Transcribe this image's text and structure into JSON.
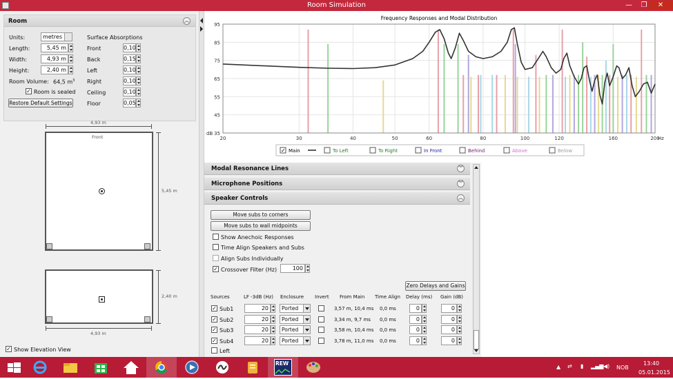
{
  "window": {
    "title": "Room Simulation",
    "buttons": [
      "—",
      "❐",
      "✕"
    ]
  },
  "room_panel": {
    "title": "Room",
    "units_label": "Units:",
    "units_value": "metres",
    "length_label": "Length:",
    "length_value": "5,45 m",
    "width_label": "Width:",
    "width_value": "4,93 m",
    "height_label": "Height:",
    "height_value": "2,40 m",
    "volume_label": "Room Volume:",
    "volume_value": "64,5 m",
    "volume_sup": "3",
    "sealed_label": "Room is sealed",
    "sealed_checked": true,
    "restore_button": "Restore Default Settings",
    "absorptions_title": "Surface Absorptions",
    "absorptions": [
      {
        "label": "Front",
        "value": "0,10"
      },
      {
        "label": "Back",
        "value": "0,15"
      },
      {
        "label": "Left",
        "value": "0,10"
      },
      {
        "label": "Right",
        "value": "0,10"
      },
      {
        "label": "Ceiling",
        "value": "0,10"
      },
      {
        "label": "Floor",
        "value": "0,05"
      }
    ]
  },
  "plan_view": {
    "width_dim": "4,93 m",
    "length_dim": "5,45 m",
    "front_label": "Front"
  },
  "elevation_view": {
    "height_dim": "2,40 m",
    "width_dim": "4,93 m"
  },
  "show_elevation": {
    "label": "Show Elevation View",
    "checked": true
  },
  "chart_data": {
    "type": "line",
    "title": "Frequency Responses and Modal Distribution",
    "ylabel": "dB",
    "xscale": "log",
    "xlim": [
      20,
      200
    ],
    "ylim": [
      35,
      95
    ],
    "x_ticks": [
      20,
      30,
      40,
      50,
      60,
      80,
      100,
      120,
      160,
      200
    ],
    "x_unit": "Hz",
    "y_ticks": [
      35,
      45,
      55,
      65,
      75,
      85,
      95
    ],
    "grid": true,
    "series": [
      {
        "name": "Main",
        "color": "#333333",
        "x": [
          20,
          25,
          30,
          35,
          40,
          45,
          50,
          55,
          58,
          60,
          62,
          63.5,
          65,
          66.5,
          67.5,
          69,
          70.5,
          72,
          74,
          77,
          80,
          84,
          88,
          91,
          93,
          94.5,
          96,
          98,
          100,
          104,
          108,
          110,
          112,
          115,
          118,
          121,
          123,
          125,
          127,
          130,
          133,
          135,
          137,
          139,
          141,
          143,
          145,
          147,
          149,
          151,
          153,
          155,
          157,
          160,
          163,
          165,
          168,
          171,
          174,
          177,
          180,
          184,
          188,
          192,
          196,
          200
        ],
        "y": [
          73,
          72,
          71.2,
          70.7,
          70.5,
          71,
          72.5,
          76,
          80,
          85,
          90.5,
          92,
          87,
          79,
          76,
          82,
          90,
          86,
          80,
          77,
          76,
          77,
          80,
          85,
          92,
          93,
          84,
          74,
          70,
          71,
          77,
          80,
          77,
          71,
          68,
          70,
          76,
          79,
          72,
          66,
          62,
          65,
          71,
          72,
          64,
          58,
          64,
          67,
          56,
          51,
          63,
          68,
          61,
          66,
          72,
          71,
          65,
          67,
          71,
          61,
          55,
          58,
          62,
          63,
          57,
          62
        ]
      }
    ],
    "modal_lines": [
      {
        "freq": 31.5,
        "level": 92,
        "color": "#e8a0a8"
      },
      {
        "freq": 35,
        "level": 84,
        "color": "#9ad49a"
      },
      {
        "freq": 47,
        "level": 64,
        "color": "#e6d890"
      },
      {
        "freq": 63,
        "level": 92,
        "color": "#e8a0a8"
      },
      {
        "freq": 65,
        "level": 84,
        "color": "#9ad49a"
      },
      {
        "freq": 70,
        "level": 84,
        "color": "#9ad49a"
      },
      {
        "freq": 72,
        "level": 67,
        "color": "#e8a0a8"
      },
      {
        "freq": 74,
        "level": 78,
        "color": "#b0a8e0"
      },
      {
        "freq": 75,
        "level": 66,
        "color": "#e6d890"
      },
      {
        "freq": 78,
        "level": 67,
        "color": "#e8a0a8"
      },
      {
        "freq": 79,
        "level": 67,
        "color": "#a8d8e8"
      },
      {
        "freq": 84,
        "level": 67,
        "color": "#a8d8e8"
      },
      {
        "freq": 86,
        "level": 67,
        "color": "#e8a0a8"
      },
      {
        "freq": 90,
        "level": 67,
        "color": "#e6d890"
      },
      {
        "freq": 94,
        "level": 92,
        "color": "#e8a0a8"
      },
      {
        "freq": 95,
        "level": 84,
        "color": "#b0a8e0"
      },
      {
        "freq": 96,
        "level": 66,
        "color": "#e6d890"
      },
      {
        "freq": 102,
        "level": 66,
        "color": "#a8d8e8"
      },
      {
        "freq": 106,
        "level": 78,
        "color": "#e8a0a8"
      },
      {
        "freq": 108,
        "level": 66,
        "color": "#e6d890"
      },
      {
        "freq": 112,
        "level": 67,
        "color": "#9ad49a"
      },
      {
        "freq": 116,
        "level": 67,
        "color": "#b0a8e0"
      },
      {
        "freq": 122,
        "level": 92,
        "color": "#e8a0a8"
      },
      {
        "freq": 124,
        "level": 66,
        "color": "#a8d8e8"
      },
      {
        "freq": 127,
        "level": 67,
        "color": "#e6d890"
      },
      {
        "freq": 130,
        "level": 67,
        "color": "#b0a8e0"
      },
      {
        "freq": 133,
        "level": 67,
        "color": "#9ad49a"
      },
      {
        "freq": 136,
        "level": 85,
        "color": "#9ad49a"
      },
      {
        "freq": 139,
        "level": 77,
        "color": "#e8a0a8"
      },
      {
        "freq": 142,
        "level": 66,
        "color": "#a8d8e8"
      },
      {
        "freq": 145,
        "level": 67,
        "color": "#b0a8e0"
      },
      {
        "freq": 148,
        "level": 67,
        "color": "#e6d890"
      },
      {
        "freq": 151,
        "level": 67,
        "color": "#9ad49a"
      },
      {
        "freq": 154,
        "level": 75,
        "color": "#a8d8e8"
      },
      {
        "freq": 157,
        "level": 67,
        "color": "#e8a0a8"
      },
      {
        "freq": 160,
        "level": 84,
        "color": "#9ad49a"
      },
      {
        "freq": 164,
        "level": 66,
        "color": "#e6d890"
      },
      {
        "freq": 168,
        "level": 67,
        "color": "#b0a8e0"
      },
      {
        "freq": 172,
        "level": 67,
        "color": "#a8d8e8"
      },
      {
        "freq": 176,
        "level": 67,
        "color": "#e8a0a8"
      },
      {
        "freq": 181,
        "level": 66,
        "color": "#e6d890"
      },
      {
        "freq": 186,
        "level": 92,
        "color": "#e8a0a8"
      },
      {
        "freq": 191,
        "level": 67,
        "color": "#9ad49a"
      },
      {
        "freq": 196,
        "level": 67,
        "color": "#b0a8e0"
      }
    ],
    "legend": [
      {
        "label": "Main",
        "checked": true,
        "color": "#000000",
        "line": true
      },
      {
        "label": "To Left",
        "checked": false,
        "color": "#2a7a2a"
      },
      {
        "label": "To Right",
        "checked": false,
        "color": "#2a7a2a"
      },
      {
        "label": "In Front",
        "checked": false,
        "color": "#2020a0"
      },
      {
        "label": "Behind",
        "checked": false,
        "color": "#702070"
      },
      {
        "label": "Above",
        "checked": false,
        "color": "#d070d0"
      },
      {
        "label": "Below",
        "checked": false,
        "color": "#a0a0a0"
      }
    ],
    "legend_position": "bottom"
  },
  "sections": {
    "modal": "Modal Resonance Lines",
    "mic": "Microphone Positions",
    "speaker": "Speaker Controls"
  },
  "speaker_controls": {
    "move_corners": "Move subs to corners",
    "move_midpoints": "Move subs to wall midpoints",
    "show_anechoic": "Show Anechoic Responses",
    "time_align": "Time Align Speakers and Subs",
    "align_individually": "Align Subs Individually",
    "crossover_label": "Crossover Filter (Hz)",
    "crossover_value": "100",
    "zero_button": "Zero Delays and Gains",
    "columns": [
      "Sources",
      "LF -3dB (Hz)",
      "Enclosure",
      "Invert",
      "From Main",
      "Time Align",
      "Delay (ms)",
      "Gain (dB)"
    ],
    "rows": [
      {
        "name": "Sub1",
        "lf": "20",
        "enclosure": "Ported",
        "from_main": "3,57 m, 10,4 ms",
        "time_align": "0,0 ms",
        "delay": "0",
        "gain": "0"
      },
      {
        "name": "Sub2",
        "lf": "20",
        "enclosure": "Ported",
        "from_main": "3,34 m, 9,7 ms",
        "time_align": "0,0 ms",
        "delay": "0",
        "gain": "0"
      },
      {
        "name": "Sub3",
        "lf": "20",
        "enclosure": "Ported",
        "from_main": "3,58 m, 10,4 ms",
        "time_align": "0,0 ms",
        "delay": "0",
        "gain": "0"
      },
      {
        "name": "Sub4",
        "lf": "20",
        "enclosure": "Ported",
        "from_main": "3,78 m, 11,0 ms",
        "time_align": "0,0 ms",
        "delay": "0",
        "gain": "0"
      }
    ],
    "partial_row": "Left"
  },
  "taskbar": {
    "time": "13:40",
    "date": "05.01.2015",
    "lang": "NOB",
    "rew_label": "REW"
  }
}
